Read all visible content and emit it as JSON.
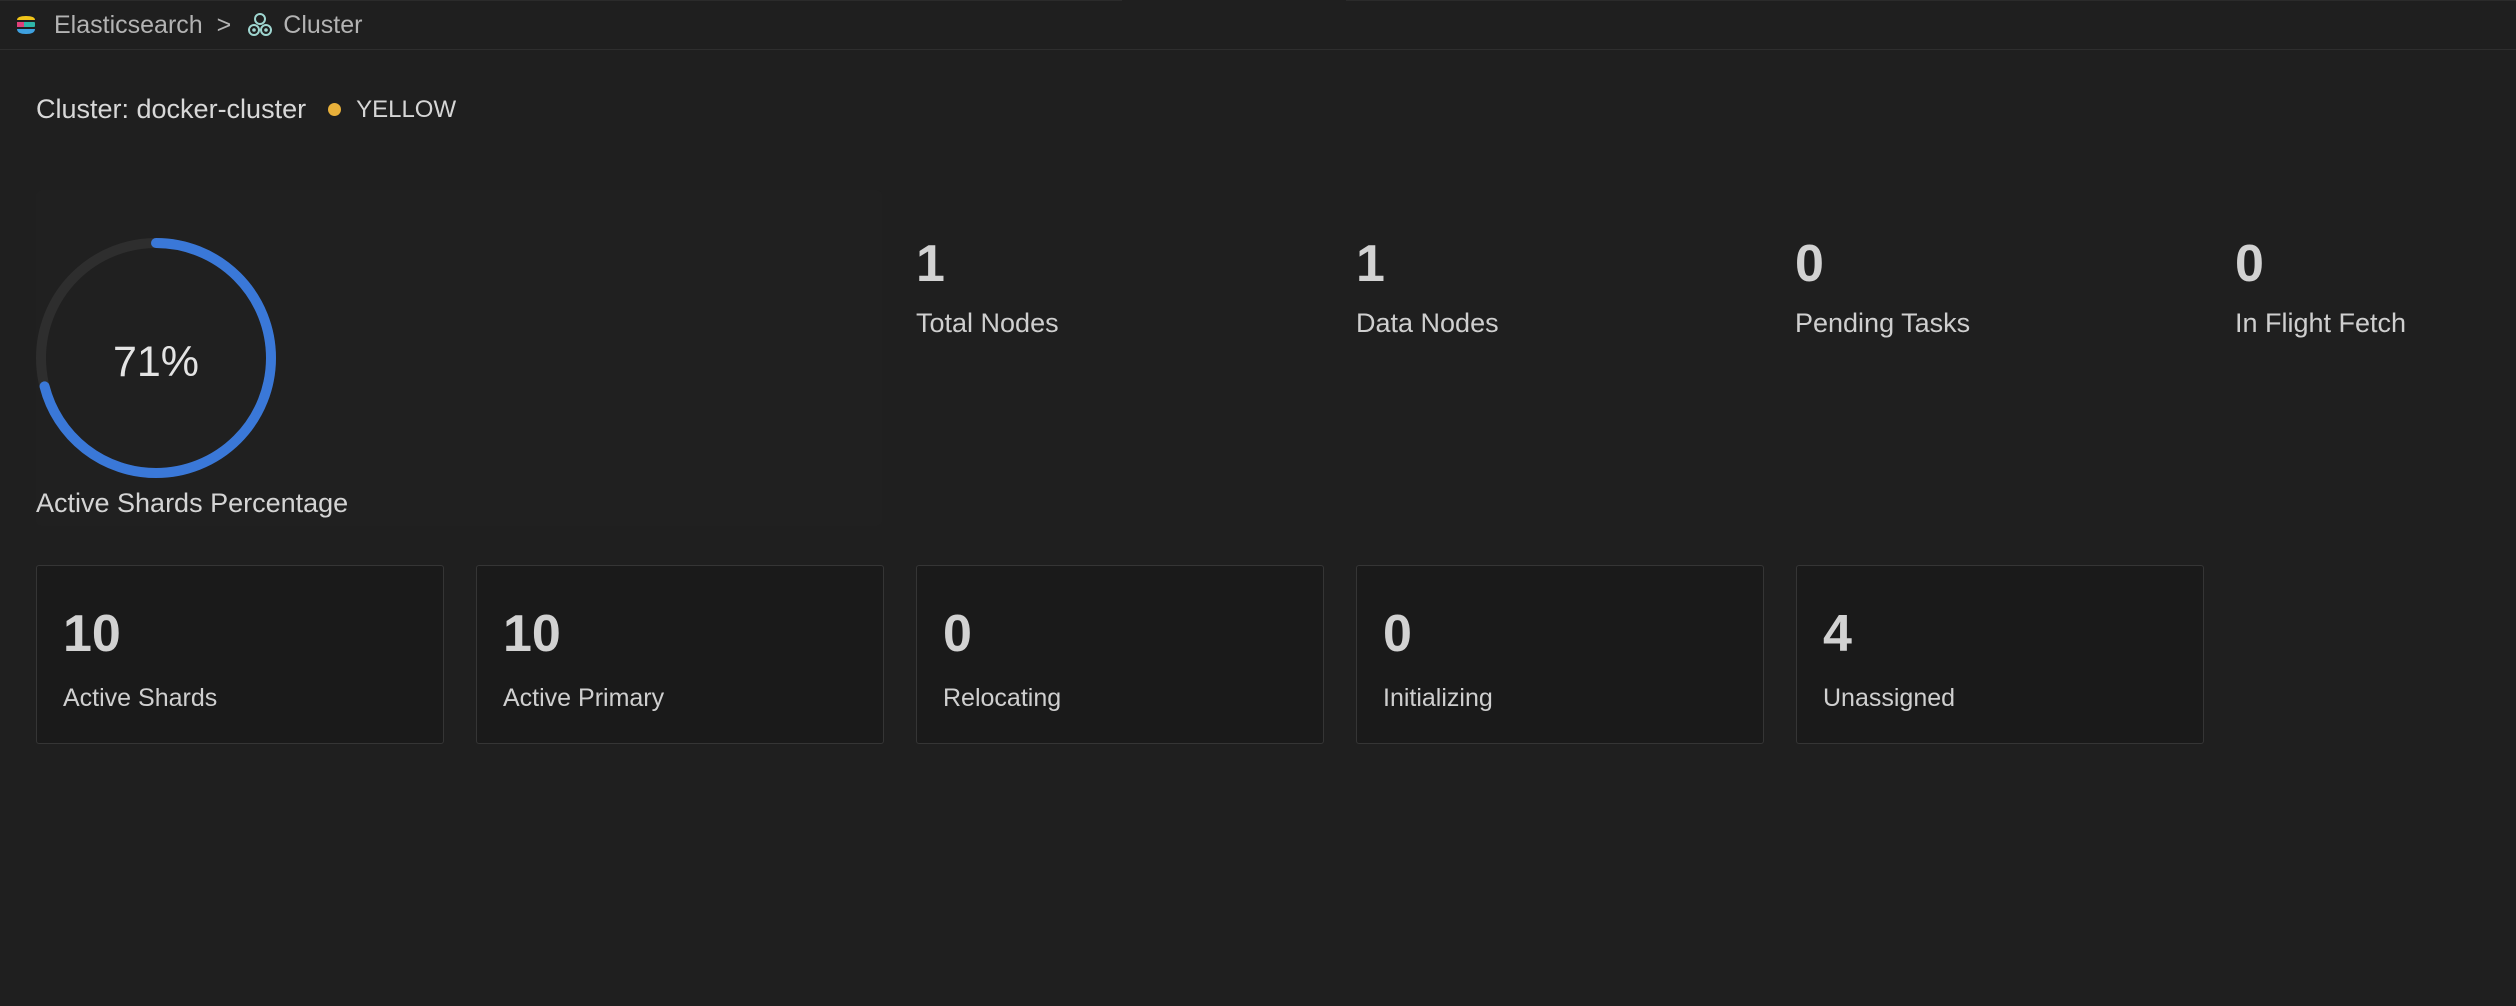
{
  "breadcrumb": {
    "root": "Elasticsearch",
    "separator": ">",
    "current": "Cluster"
  },
  "cluster": {
    "label": "Cluster: docker-cluster",
    "status": "YELLOW",
    "status_color": "#e8b03a"
  },
  "gauge": {
    "value_text": "71%",
    "value": 0.71,
    "label": "Active Shards Percentage",
    "track_color": "#2e2e2e",
    "fill_color": "#3a78d8"
  },
  "stats": {
    "total_nodes": {
      "value": "1",
      "label": "Total Nodes"
    },
    "data_nodes": {
      "value": "1",
      "label": "Data Nodes"
    },
    "pending_tasks": {
      "value": "0",
      "label": "Pending Tasks"
    },
    "in_flight_fetch": {
      "value": "0",
      "label": "In Flight Fetch"
    }
  },
  "cards": {
    "active_shards": {
      "value": "10",
      "label": "Active Shards"
    },
    "active_primary": {
      "value": "10",
      "label": "Active Primary"
    },
    "relocating": {
      "value": "0",
      "label": "Relocating"
    },
    "initializing": {
      "value": "0",
      "label": "Initializing"
    },
    "unassigned": {
      "value": "4",
      "label": "Unassigned"
    }
  }
}
